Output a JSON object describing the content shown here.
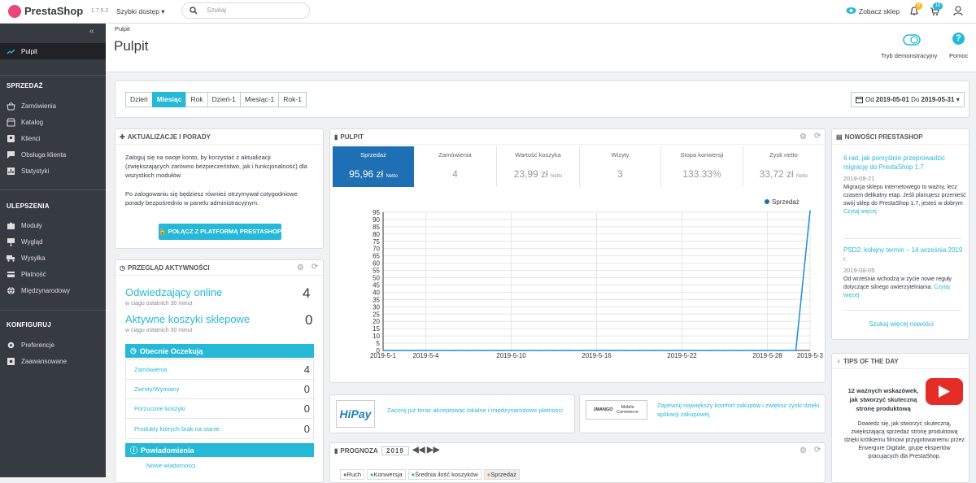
{
  "topbar": {
    "logo": "PrestaShop",
    "version": "1.7.5.2",
    "quick_access": "Szybki dostęp",
    "search_placeholder": "Szukaj",
    "view_store": "Zobacz sklep",
    "notif_count": "6",
    "msg_count": "10"
  },
  "header": {
    "breadcrumb": "Pulpit",
    "title": "Pulpit",
    "demo_label": "Tryb demonstracyjny",
    "help_label": "Pomoc"
  },
  "sidebar": {
    "active": "Pulpit",
    "sections": [
      {
        "title": "SPRZEDAŻ",
        "items": [
          "Zamówienia",
          "Katalog",
          "Klienci",
          "Obsługa klienta",
          "Statystyki"
        ]
      },
      {
        "title": "ULEPSZENIA",
        "items": [
          "Moduły",
          "Wygląd",
          "Wysyłka",
          "Płatność",
          "Międzynarodowy"
        ]
      },
      {
        "title": "KONFIGURUJ",
        "items": [
          "Preferencje",
          "Zaawansowane"
        ]
      }
    ]
  },
  "period": {
    "buttons": [
      "Dzień",
      "Miesiąc",
      "Rok",
      "Dzień-1",
      "Miesiąc-1",
      "Rok-1"
    ],
    "active": "Miesiąc",
    "od": "Od",
    "from": "2019-05-01",
    "do": "Do",
    "to": "2019-05-31"
  },
  "updates": {
    "title": "AKTUALIZACJE I PORADY",
    "text1": "Zaloguj się na swoje konto, by korzystać z aktualizacji (zwiększających zarówno bezpieczeństwo, jak i funkcjonalność) dla wszystkich modułów.",
    "text2": "Po zalogowaniu się będziesz również otrzymywał cotygodniowe porady bezpośrednio w panelu administracyjnym.",
    "button": "POŁĄCZ Z PLATFORMĄ PRESTASHOP"
  },
  "activity": {
    "title": "PRZEGLĄD AKTYWNOŚCI",
    "online_label": "Odwiedzający online",
    "online_value": "4",
    "online_sub": "w ciągu ostatnich 30 minut",
    "carts_label": "Aktywne koszyki sklepowe",
    "carts_value": "0",
    "carts_sub": "w ciągu ostatnich 30 minut",
    "pending_title": "Obecnie Oczekują",
    "pending": [
      {
        "label": "Zamówienia",
        "value": "4"
      },
      {
        "label": "Zwroty/Wymiany",
        "value": "0"
      },
      {
        "label": "Porzucone koszyki",
        "value": "0"
      },
      {
        "label": "Produkty których brak na stanie",
        "value": "0"
      }
    ],
    "notif_title": "Powiadomienia",
    "notif_new": "Nowe wiadomości"
  },
  "dashboard": {
    "title": "PULPIT",
    "kpis": [
      {
        "label": "Sprzedaż",
        "value": "95,96 zł",
        "suffix": "Netto"
      },
      {
        "label": "Zamówienia",
        "value": "4",
        "suffix": ""
      },
      {
        "label": "Wartość koszyka",
        "value": "23,99 zł",
        "suffix": "Netto"
      },
      {
        "label": "Wizyty",
        "value": "3",
        "suffix": ""
      },
      {
        "label": "Stopa konwersji",
        "value": "133.33%",
        "suffix": ""
      },
      {
        "label": "Zysk netto",
        "value": "33,72 zł",
        "suffix": "Netto"
      }
    ]
  },
  "partners": {
    "hipay_logo": "HiPay",
    "hipay_text": "Zacznij już teraz akceptować lokalne i międzynarodowe płatności",
    "jmango_logo": "JMANGO",
    "jmango_logo2": "Mobile Commerce",
    "jmango_text": "Zapewnij największy komfort zakupów i zwiększ zyski dzięki aplikacji zakupowej"
  },
  "forecast": {
    "title": "PROGNOZA",
    "year": "2019",
    "tabs": [
      "Ruch",
      "Konwersja",
      "Średnia ilość koszyków",
      "Sprzedaż"
    ]
  },
  "news": {
    "title": "NOWOŚCI PRESTASHOP",
    "items": [
      {
        "title": "6 rad, jak pomyślnie przeprowadzić migrację do PrestaShop 1.7",
        "date": "2019-08-21",
        "text": "Migracja sklepu internetowego to ważny, lecz czasem delikatny etap. Jeśli planujesz przenieść swój sklep do PrestaShop 1.7, jesteś w dobrym",
        "more": "Czytaj więcej"
      },
      {
        "title": "PSD2: kolejny termin – 14 września 2019 r.",
        "date": "2019-08-05",
        "text": "Od września wchodzą w życie nowe reguły dotyczące silnego uwierzytelniania.",
        "more": "Czytaj więcej"
      }
    ],
    "read_more": "Szukaj więcej nowości"
  },
  "tips": {
    "title": "TIPS OF THE DAY",
    "heading": "12 ważnych wskazówek, jak stworzyć skuteczną stronę produktową",
    "text": "Dowiedz się, jak stworzyć skuteczną, zwiększającą sprzedaż stronę produktową dzięki krótkiemu filmowi przygotowanemu przez Envergure Digitale, grupę ekspertów pracujących dla PrestaShop."
  },
  "colors": {
    "accent": "#25b9d7",
    "sidebar": "#363a41",
    "chart_line": "#1a8fd6",
    "youtube": "#e52d27"
  },
  "chart_data": {
    "type": "line",
    "legend": "Sprzedaż",
    "x": [
      "2019-5-1",
      "2019-5-2",
      "2019-5-3",
      "2019-5-4",
      "2019-5-5",
      "2019-5-6",
      "2019-5-7",
      "2019-5-8",
      "2019-5-9",
      "2019-5-10",
      "2019-5-11",
      "2019-5-12",
      "2019-5-13",
      "2019-5-14",
      "2019-5-15",
      "2019-5-16",
      "2019-5-17",
      "2019-5-18",
      "2019-5-19",
      "2019-5-20",
      "2019-5-21",
      "2019-5-22",
      "2019-5-23",
      "2019-5-24",
      "2019-5-25",
      "2019-5-26",
      "2019-5-27",
      "2019-5-28",
      "2019-5-29",
      "2019-5-30",
      "2019-5-31"
    ],
    "values": [
      0,
      0,
      0,
      0,
      0,
      0,
      0,
      0,
      0,
      0,
      0,
      0,
      0,
      0,
      0,
      0,
      0,
      0,
      0,
      0,
      0,
      0,
      0,
      0,
      0,
      0,
      0,
      0,
      0,
      0,
      95.96
    ],
    "xticks": [
      "2019-5-1",
      "2019-5-4",
      "2019-5-10",
      "2019-5-16",
      "2019-5-22",
      "2019-5-28",
      "2019-5-3"
    ],
    "yticks": [
      "0",
      "5",
      "10",
      "15",
      "20",
      "25",
      "30",
      "35",
      "40",
      "45",
      "50",
      "55",
      "60",
      "65",
      "70",
      "75",
      "80",
      "85",
      "90",
      "95"
    ],
    "ylim": [
      0,
      95
    ]
  }
}
